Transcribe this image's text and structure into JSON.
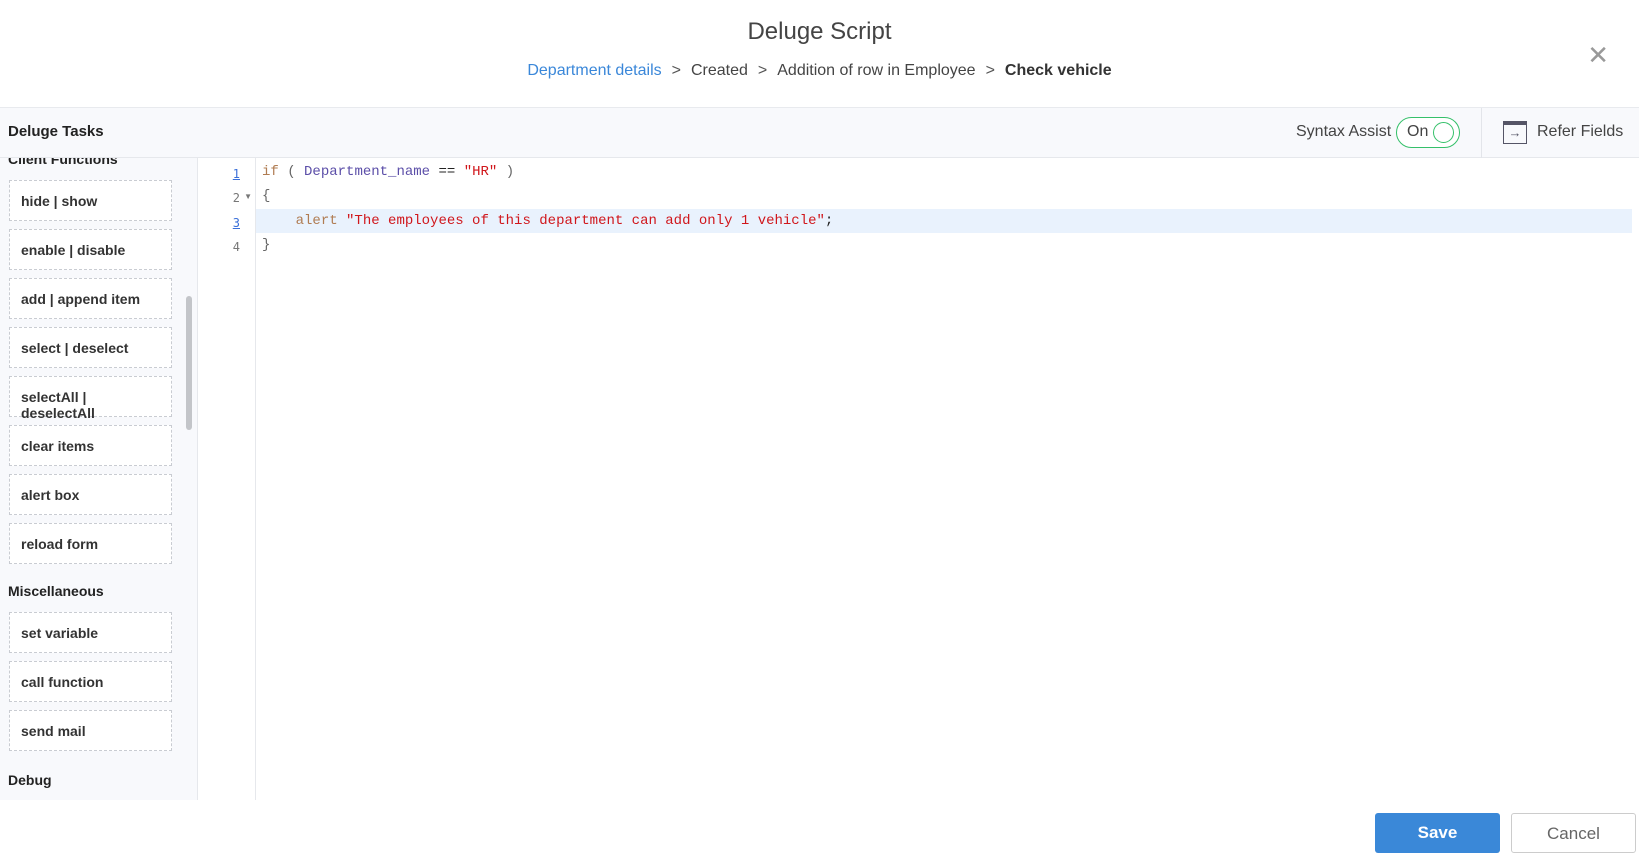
{
  "header": {
    "title": "Deluge Script",
    "breadcrumb": [
      "Department details",
      "Created",
      "Addition of row in Employee",
      "Check vehicle"
    ],
    "separator": ">",
    "close_icon": "close-icon"
  },
  "toolbar": {
    "title": "Deluge Tasks",
    "syntax_assist_label": "Syntax Assist",
    "syntax_assist_state": "On",
    "refer_fields": "Refer Fields",
    "toggle_color": "#35c06a"
  },
  "sidebar": {
    "sections": [
      {
        "title": "Client Functions",
        "items": [
          "hide | show",
          "enable | disable",
          "add | append item",
          "select | deselect",
          "selectAll | deselectAll",
          "clear items",
          "alert box",
          "reload form"
        ]
      },
      {
        "title": "Miscellaneous",
        "items": [
          "set variable",
          "call function",
          "send mail"
        ]
      },
      {
        "title": "Debug",
        "items": []
      }
    ]
  },
  "editor": {
    "line_numbers": [
      "1",
      "2",
      "3",
      "4"
    ],
    "lines": [
      {
        "t1": "if",
        "t2": "(",
        "t3": "Department_name",
        "t4": "==",
        "t5": "\"HR\"",
        "t6": ")"
      },
      {
        "t1": "{"
      },
      {
        "t1": "alert",
        "t2": "\"The employees of this department can add only 1 vehicle\"",
        "t3": ";"
      },
      {
        "t1": "}"
      }
    ]
  },
  "footer": {
    "save": "Save",
    "cancel": "Cancel",
    "accent": "#3a88d8"
  }
}
